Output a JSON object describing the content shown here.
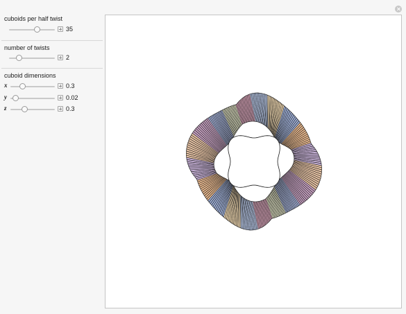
{
  "controls": {
    "cuboids_per_half_twist": {
      "label": "cuboids per half twist",
      "value": "35",
      "level": 0.6
    },
    "number_of_twists": {
      "label": "number of twists",
      "value": "2",
      "level": 0.2
    },
    "cuboid_dimensions": {
      "label": "cuboid dimensions",
      "x": {
        "var": "x",
        "value": "0.3",
        "level": 0.28
      },
      "y": {
        "var": "y",
        "value": "0.02",
        "level": 0.1
      },
      "z": {
        "var": "z",
        "value": "0.3",
        "level": 0.33
      }
    }
  },
  "icons": {
    "close": "close-icon",
    "increment": "plus-icon"
  },
  "colors": {
    "band_palette": [
      "#e7c3a4",
      "#c9a3c4",
      "#a9b7e0",
      "#e6e8c8",
      "#d8a3b8",
      "#b8c8e8",
      "#f0d8b0",
      "#9fb0d8",
      "#e9b98e",
      "#c6b0d6"
    ]
  }
}
